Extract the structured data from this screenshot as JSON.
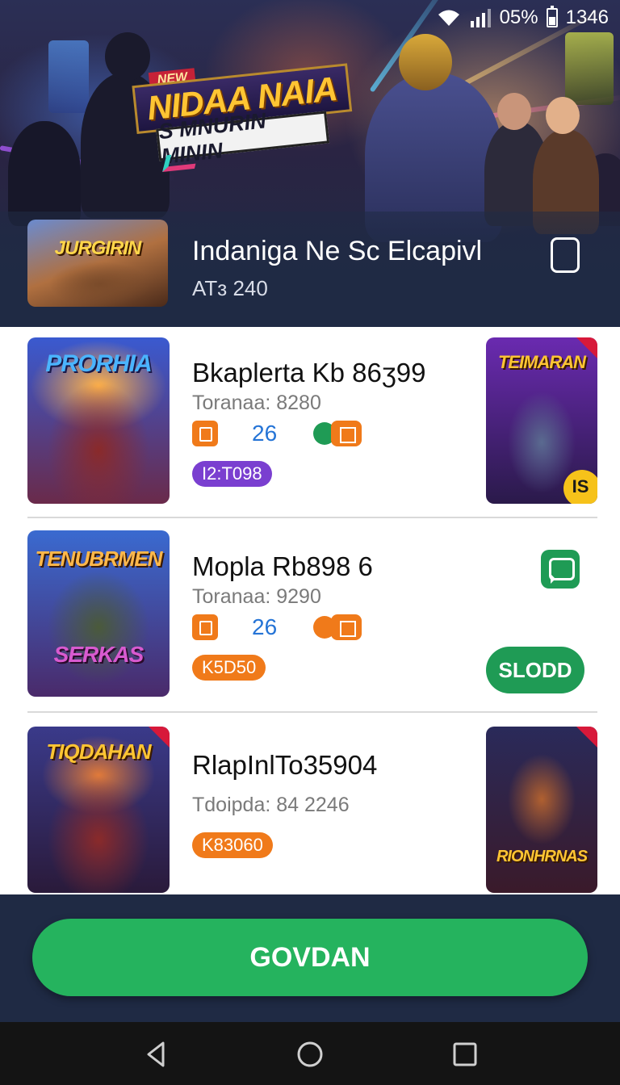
{
  "status_bar": {
    "battery_percent": "05%",
    "time": "1346"
  },
  "hero": {
    "logo_flag": "NEW",
    "logo_title": "NIDAA NAIA",
    "logo_subtitle": "S MNURIN MININ",
    "featured": {
      "thumb_title": "JURGIRIN",
      "title": "Indaniga Ne Sc Elcapivl",
      "subtitle": "ATɜ 240"
    }
  },
  "list": [
    {
      "thumb_title": "PRORHIA",
      "title": "Bkaplerta Kb 86ʒ99",
      "subtitle": "Toranaa: 8280",
      "count": "26",
      "tag": "I2:T098",
      "side_title": "TEIMARAN",
      "side_badge": "IS"
    },
    {
      "thumb_title": "TENUBRMEN",
      "thumb_caption": "SERKAS",
      "title": "Mopla  Rb898 6",
      "subtitle": "Toranaa: 9290",
      "count": "26",
      "tag": "K5D50",
      "action_label": "SLODD"
    },
    {
      "thumb_title": "TIQDAHAN",
      "title": "RlapInlTo35904",
      "subtitle": "Tdoipda: 84 2246",
      "tag": "K83060",
      "side_title": "RIONHRNAS"
    }
  ],
  "cta": {
    "label": "GOVDAN"
  },
  "colors": {
    "accent_green": "#25b35e",
    "orange": "#f07a1a",
    "purple": "#7a3fd0",
    "navy": "#1f2a44"
  },
  "icons": [
    "wifi-icon",
    "signal-icon",
    "battery-icon",
    "device-icon",
    "calendar-icon",
    "gift-icon",
    "chat-icon",
    "back-icon",
    "home-icon",
    "recents-icon"
  ]
}
